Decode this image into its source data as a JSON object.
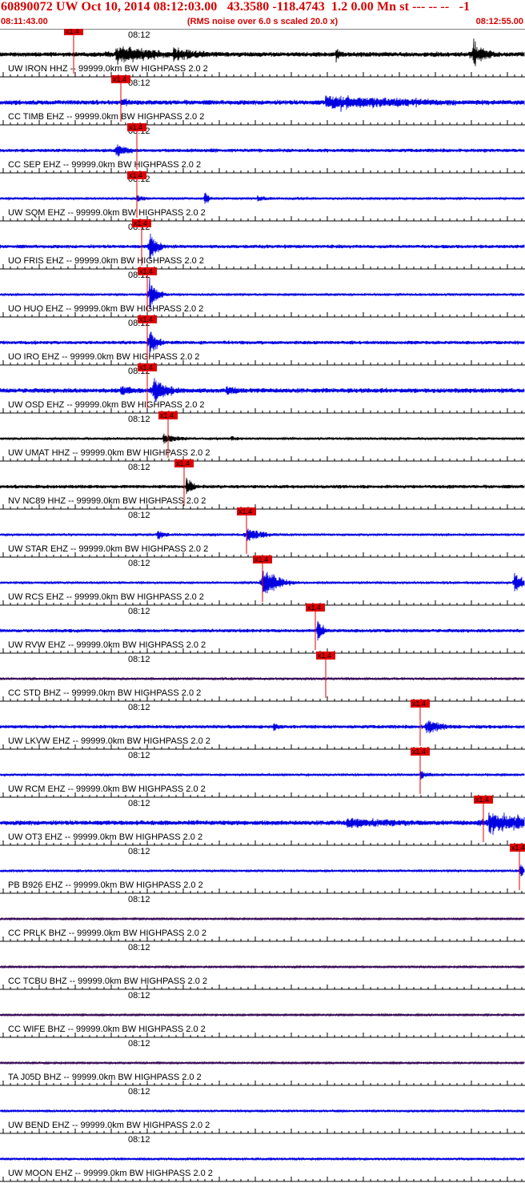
{
  "header": {
    "title": "60890072 UW Oct 10, 2014 08:12:03.00   43.3580 -118.4743  1.2 0.00 Mn st --- -- --   -1",
    "subtitle": "(RMS noise over 6.0 s scaled 20.0 x)",
    "time_start": "08:11:43.00",
    "time_end": "08:12:55.00"
  },
  "colors": {
    "header_text": "#d40000",
    "pick_marker": "#e00000",
    "grid": "#000000",
    "trace_blue": "#0000e0",
    "trace_black": "#000000",
    "trace_purple": "#300050"
  },
  "chart_data": {
    "type": "line",
    "title": "60890072 UW Oct 10, 2014 08:12:03.00   43.3580 -118.4743  1.2 0.00 Mn st --- -- --   -1",
    "subtitle": "(RMS noise over 6.0 s scaled 20.0 x)",
    "x_range": [
      "08:11:43.00",
      "08:12:55.00"
    ],
    "x_tick_label": "08:12",
    "pick_label": "x1.4",
    "grid": true,
    "series": [
      {
        "name": "UW IRON HHZ -- 99999.0km BW  HIGHPASS  2.0  2",
        "color": "black",
        "noise": 4,
        "pick": 0.14,
        "events": [
          [
            0.22,
            5,
            0.1,
            26
          ],
          [
            0.33,
            6,
            0.08,
            20
          ],
          [
            0.64,
            1.5,
            0.01,
            18
          ],
          [
            0.9,
            2,
            0.03,
            26
          ]
        ]
      },
      {
        "name": "CC TIMB EHZ -- 99999.0km BW  HIGHPASS  2.0  2",
        "color": "blue",
        "noise": 4,
        "pick": 0.23,
        "events": [
          [
            0.23,
            1,
            0.03,
            10
          ],
          [
            0.62,
            5,
            0.25,
            20
          ]
        ]
      },
      {
        "name": "CC SEP EHZ -- 99999.0km BW  HIGHPASS  2.0  2",
        "color": "blue",
        "noise": 3,
        "pick": 0.26,
        "events": [
          [
            0.22,
            1.5,
            0.03,
            14
          ],
          [
            0.4,
            3,
            0.06,
            6
          ]
        ]
      },
      {
        "name": "UW SQM EHZ -- 99999.0km BW  HIGHPASS  2.0  2",
        "color": "blue",
        "noise": 2,
        "pick": 0.26,
        "events": [
          [
            0.26,
            0.5,
            0.02,
            8
          ],
          [
            0.39,
            0.5,
            0.01,
            14
          ],
          [
            0.49,
            3,
            0.03,
            10
          ]
        ]
      },
      {
        "name": "UO FRIS EHZ -- 99999.0km BW  HIGHPASS  2.0  2",
        "color": "blue",
        "noise": 3,
        "pick": 0.27,
        "events": [
          [
            0.285,
            1.3,
            0.015,
            30
          ]
        ]
      },
      {
        "name": "UO HUO EHZ -- 99999.0km BW  HIGHPASS  2.0  2",
        "color": "blue",
        "noise": 2,
        "pick": 0.28,
        "events": [
          [
            0.285,
            1,
            0.015,
            30
          ]
        ]
      },
      {
        "name": "UO IRO EHZ -- 99999.0km BW  HIGHPASS  2.0  2",
        "color": "blue",
        "noise": 3,
        "pick": 0.28,
        "events": [
          [
            0.285,
            1.3,
            0.015,
            30
          ]
        ]
      },
      {
        "name": "UW OSD EHZ -- 99999.0km BW  HIGHPASS  2.0  2",
        "color": "blue",
        "noise": 4,
        "pick": 0.28,
        "events": [
          [
            0.23,
            1,
            0.05,
            10
          ],
          [
            0.29,
            2,
            0.03,
            28
          ],
          [
            0.43,
            2.5,
            0.03,
            16
          ]
        ]
      },
      {
        "name": "UW UMAT HHZ -- 99999.0km BW  HIGHPASS  2.0  2",
        "color": "black",
        "noise": 2,
        "pick": 0.32,
        "events": [
          [
            0.31,
            1,
            0.04,
            10
          ],
          [
            0.44,
            4,
            0.03,
            8
          ]
        ]
      },
      {
        "name": "NV NC89 HHZ -- 99999.0km BW  HIGHPASS  2.0  2",
        "color": "black",
        "noise": 3,
        "pick": 0.35,
        "events": [
          [
            0.355,
            1.5,
            0.012,
            22
          ]
        ]
      },
      {
        "name": "UW STAR EHZ -- 99999.0km BW  HIGHPASS  2.0  2",
        "color": "blue",
        "noise": 2,
        "pick": 0.47,
        "events": [
          [
            0.3,
            0.7,
            0.02,
            10
          ],
          [
            0.47,
            0.8,
            0.03,
            16
          ],
          [
            0.4,
            5,
            0.02,
            6
          ]
        ]
      },
      {
        "name": "UW RCS EHZ -- 99999.0km BW  HIGHPASS  2.0  2",
        "color": "blue",
        "noise": 2,
        "pick": 0.5,
        "events": [
          [
            0.5,
            1.2,
            0.03,
            30
          ],
          [
            0.98,
            3,
            0.015,
            30
          ]
        ]
      },
      {
        "name": "UW RVW EHZ -- 99999.0km BW  HIGHPASS  2.0  2",
        "color": "blue",
        "noise": 3,
        "pick": 0.6,
        "events": [
          [
            0.605,
            1,
            0.01,
            28
          ]
        ]
      },
      {
        "name": "CC STD BHZ -- 99999.0km BW  HIGHPASS  2.0  2",
        "color": "purple",
        "noise": 2,
        "pick": 0.62,
        "events": []
      },
      {
        "name": "UW LKVW EHZ -- 99999.0km BW  HIGHPASS  2.0  2",
        "color": "blue",
        "noise": 3,
        "pick": 0.8,
        "events": [
          [
            0.52,
            3,
            0.02,
            12
          ],
          [
            0.81,
            2.5,
            0.04,
            20
          ]
        ]
      },
      {
        "name": "UW RCM EHZ -- 99999.0km BW  HIGHPASS  2.0  2",
        "color": "blue",
        "noise": 2,
        "pick": 0.8,
        "events": [
          [
            0.8,
            1,
            0.02,
            10
          ]
        ]
      },
      {
        "name": "UW OT3 EHZ -- 99999.0km BW  HIGHPASS  2.0  2",
        "color": "blue",
        "noise": 4,
        "pick": 0.92,
        "events": [
          [
            0.66,
            2.5,
            0.2,
            14
          ],
          [
            0.93,
            1.5,
            0.1,
            22
          ]
        ]
      },
      {
        "name": "PB B926 EHZ -- 99999.0km BW  HIGHPASS  2.0  2",
        "color": "blue",
        "noise": 2,
        "pick": 0.99,
        "events": [
          [
            0.99,
            3,
            0.01,
            24
          ]
        ]
      },
      {
        "name": "CC PRLK BHZ -- 99999.0km BW  HIGHPASS  2.0  2",
        "color": "purple",
        "noise": 1.5,
        "pick": null,
        "events": []
      },
      {
        "name": "CC TCBU BHZ -- 99999.0km BW  HIGHPASS  2.0  2",
        "color": "purple",
        "noise": 1.5,
        "pick": null,
        "events": []
      },
      {
        "name": "CC WIFE BHZ -- 99999.0km BW  HIGHPASS  2.0  2",
        "color": "purple",
        "noise": 1.5,
        "pick": null,
        "events": []
      },
      {
        "name": "TA J05D BHZ -- 99999.0km BW  HIGHPASS  2.0  2",
        "color": "purple",
        "noise": 1.5,
        "pick": null,
        "events": []
      },
      {
        "name": "UW BEND EHZ -- 99999.0km BW  HIGHPASS  2.0  2",
        "color": "blue",
        "noise": 2,
        "pick": null,
        "events": []
      },
      {
        "name": "UW MOON EHZ -- 99999.0km BW  HIGHPASS  2.0  2",
        "color": "blue",
        "noise": 2,
        "pick": null,
        "events": []
      }
    ]
  }
}
